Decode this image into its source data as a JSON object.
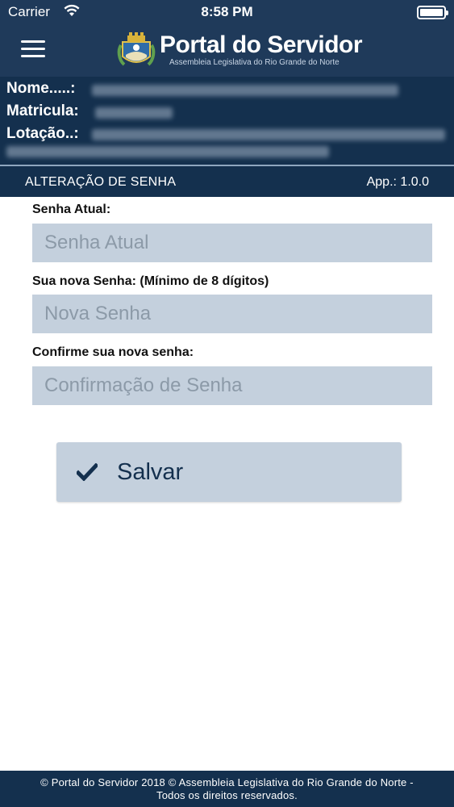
{
  "status_bar": {
    "carrier": "Carrier",
    "time": "8:58 PM"
  },
  "header": {
    "menu_icon": "hamburger-menu-icon",
    "logo_icon": "coat-of-arms-icon",
    "brand_title": "Portal do Servidor",
    "brand_subtitle": "Assembleia Legislativa do Rio Grande do Norte"
  },
  "user_info": {
    "name_label": "Nome.....:",
    "registration_label": "Matricula:",
    "department_label": "Lotação..:"
  },
  "page": {
    "title": "ALTERAÇÃO DE SENHA",
    "version": "App.: 1.0.0"
  },
  "form": {
    "current_label": "Senha Atual:",
    "current_placeholder": "Senha Atual",
    "new_label": "Sua nova Senha: (Mínimo de 8 dígitos)",
    "new_placeholder": "Nova Senha",
    "confirm_label": "Confirme sua nova senha:",
    "confirm_placeholder": "Confirmação de Senha",
    "save_label": "Salvar",
    "save_icon": "checkmark-icon"
  },
  "footer": {
    "line1": "© Portal do Servidor 2018 © Assembleia Legislativa do Rio Grande do Norte -",
    "line2": "Todos os direitos reservados."
  },
  "colors": {
    "primary": "#14304e",
    "header": "#1f3a5a",
    "field": "#c4d0dd"
  }
}
